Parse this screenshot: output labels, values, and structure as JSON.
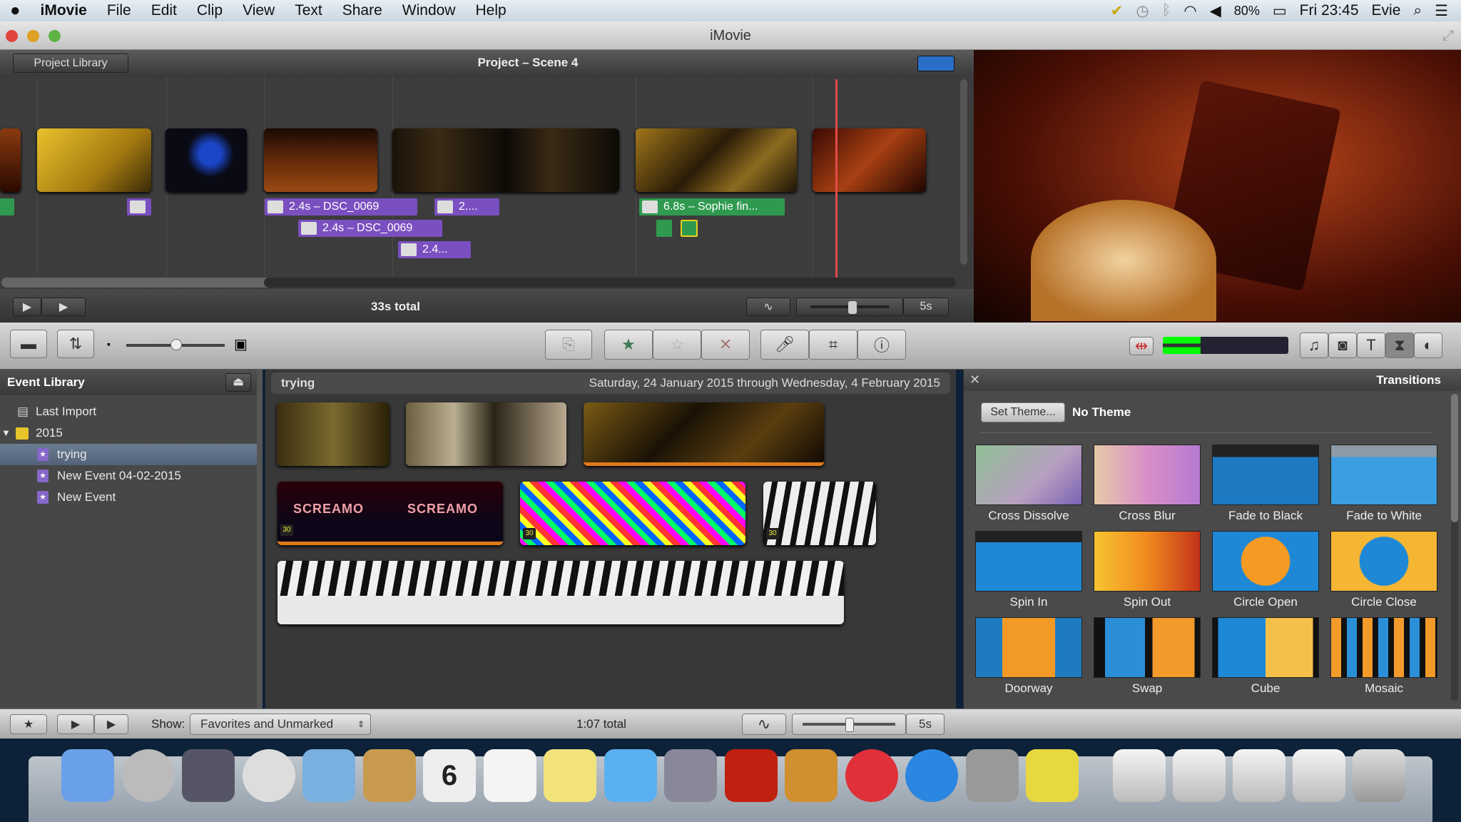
{
  "menubar": {
    "app": "iMovie",
    "items": [
      "File",
      "Edit",
      "Clip",
      "View",
      "Text",
      "Share",
      "Window",
      "Help"
    ],
    "battery": "80%",
    "clock": "Fri 23:45",
    "user": "Evie"
  },
  "window": {
    "title": "iMovie"
  },
  "project": {
    "back_label": "Project Library",
    "title": "Project – Scene 4",
    "total": "33s total",
    "zoom_label": "5s",
    "labels": [
      {
        "text": "2.4s – DSC_0069",
        "color": "purple"
      },
      {
        "text": "2....",
        "color": "purple"
      },
      {
        "text": "2.4s – DSC_0069",
        "color": "purple"
      },
      {
        "text": "2.4...",
        "color": "purple"
      },
      {
        "text": "6.8s – Sophie fin...",
        "color": "green"
      }
    ]
  },
  "event_library": {
    "title": "Event Library",
    "items": [
      {
        "label": "Last Import"
      },
      {
        "label": "2015"
      },
      {
        "label": "trying",
        "selected": true
      },
      {
        "label": "New Event 04-02-2015"
      },
      {
        "label": "New Event"
      }
    ]
  },
  "browser": {
    "event_name": "trying",
    "date_range": "Saturday, 24 January 2015 through Wednesday, 4 February 2015",
    "badge": "30",
    "title_text": "SCREAMO"
  },
  "transitions": {
    "title": "Transitions",
    "set_theme": "Set Theme...",
    "theme": "No Theme",
    "items": [
      {
        "name": "Cross Dissolve",
        "bg": "linear-gradient(135deg,#8fbf95,#b89fc0 60%,#7a62b4)"
      },
      {
        "name": "Cross Blur",
        "bg": "linear-gradient(90deg,#e8c9a8,#d88fc8,#b67ad0)"
      },
      {
        "name": "Fade to Black",
        "bg": "linear-gradient(#222 0 20%,#1d79c2 20%)"
      },
      {
        "name": "Fade to White",
        "bg": "linear-gradient(#8c9aa6 0 20%,#3a9ee0 20%)"
      },
      {
        "name": "Spin In",
        "bg": "linear-gradient(#222 0 18%,#1f88d6 18%)"
      },
      {
        "name": "Spin Out",
        "bg": "linear-gradient(90deg,#f7c431,#f08a1e,#c3321a)"
      },
      {
        "name": "Circle Open",
        "bg": "radial-gradient(circle,#f59a22 40%,#1f88d6 41%)"
      },
      {
        "name": "Circle Close",
        "bg": "radial-gradient(circle,#1f88d6 40%,#f5b634 41%)"
      },
      {
        "name": "Doorway",
        "bg": "linear-gradient(90deg,#1f7bc0 0 25%,#f39a26 25% 75%,#1f7bc0 75%)"
      },
      {
        "name": "Swap",
        "bg": "linear-gradient(90deg,#111 0 10%,#2b8fd8 10% 48%,#111 48% 55%,#f29a2a 55% 95%,#111 95%)"
      },
      {
        "name": "Cube",
        "bg": "linear-gradient(90deg,#111 0 5%,#1f88d6 5% 50%,#f5c04a 50% 95%,#111 95%)"
      },
      {
        "name": "Mosaic",
        "bg": "repeating-linear-gradient(90deg,#f29a2a 0 14px,#111 14px 22px,#2b8fd8 22px 36px,#111 36px 44px)"
      }
    ]
  },
  "bottombar": {
    "show_label": "Show:",
    "filter": "Favorites and Unmarked",
    "total": "1:07 total",
    "zoom_label": "5s"
  },
  "dock": {
    "calendar_day": "6",
    "apps": [
      "finder",
      "launchpad",
      "photo-booth",
      "safari",
      "mail",
      "contacts",
      "calendar",
      "reminders",
      "notes",
      "messages",
      "facetime",
      "photo-booth-2",
      "iphoto",
      "itunes",
      "app-store",
      "system-preferences",
      "imovie"
    ]
  }
}
